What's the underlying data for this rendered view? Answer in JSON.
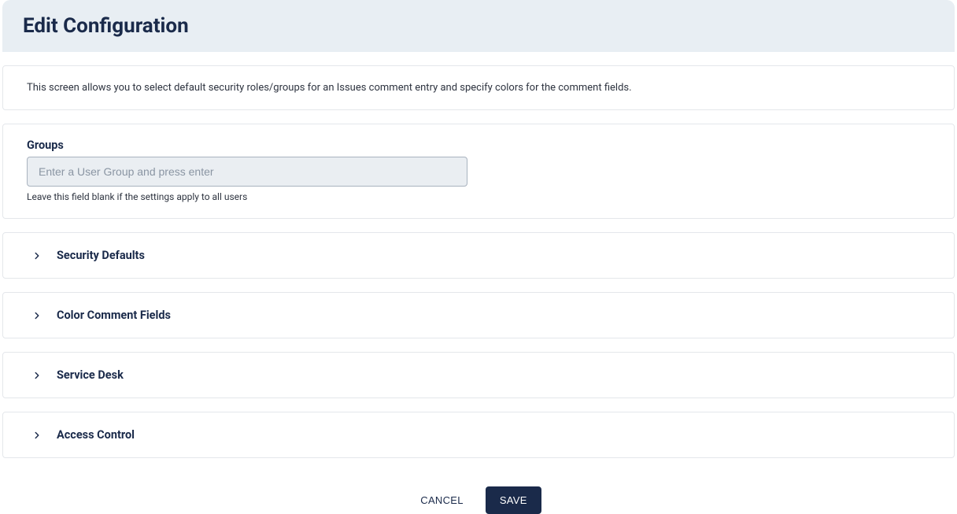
{
  "header": {
    "title": "Edit Configuration"
  },
  "description": {
    "text": "This screen allows you to select default security roles/groups for an Issues comment entry and specify colors for the comment fields."
  },
  "groups": {
    "label": "Groups",
    "placeholder": "Enter a User Group and press enter",
    "value": "",
    "helper": "Leave this field blank if the settings apply to all users"
  },
  "accordions": {
    "security_defaults": {
      "title": "Security Defaults"
    },
    "color_comment_fields": {
      "title": "Color Comment Fields"
    },
    "service_desk": {
      "title": "Service Desk"
    },
    "access_control": {
      "title": "Access Control"
    }
  },
  "footer": {
    "cancel": "CANCEL",
    "save": "SAVE"
  },
  "colors": {
    "header_bg": "#e8eef3",
    "primary_dark": "#1a2a4a",
    "border": "#e4e7eb",
    "input_bg": "#eaeef2",
    "input_border": "#a9b3bf"
  }
}
